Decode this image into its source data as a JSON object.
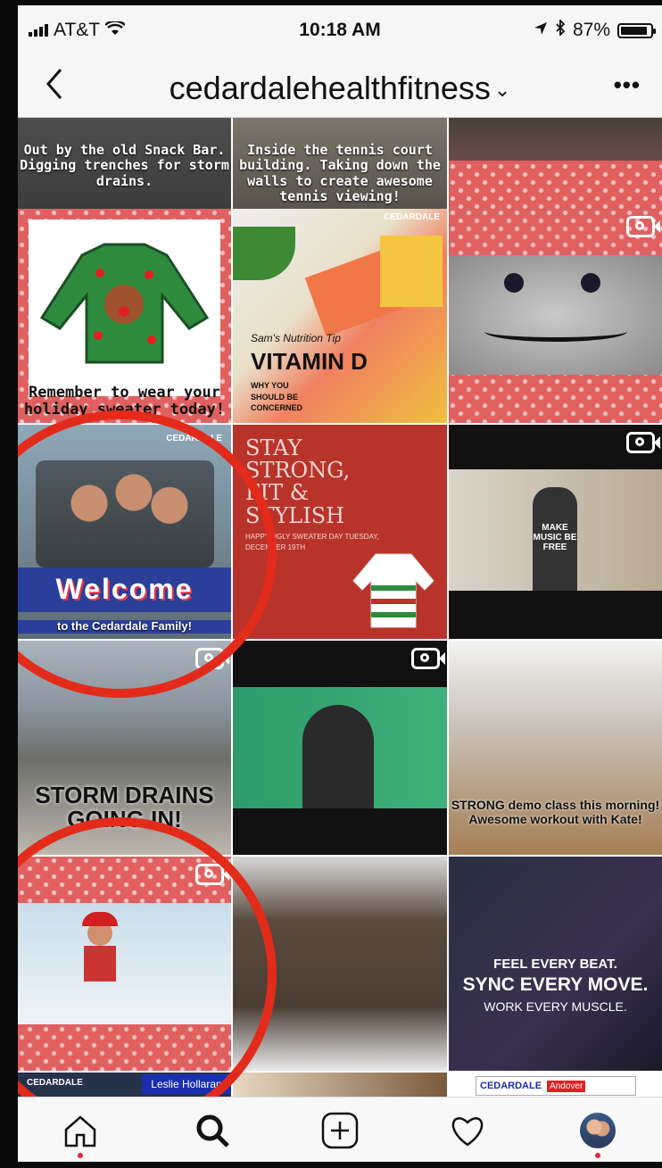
{
  "status_bar": {
    "carrier": "AT&T",
    "time": "10:18 AM",
    "battery": "87%"
  },
  "header": {
    "back_icon": "chevron-left-icon",
    "username": "cedardalehealthfitness",
    "more_icon": "more-dots-icon"
  },
  "grid": {
    "posts": [
      {
        "caption": "Out by the old Snack Bar. Digging trenches for storm drains.",
        "video": false
      },
      {
        "caption": "Inside the tennis court building. Taking down the walls to create awesome tennis viewing!",
        "video": false
      },
      {
        "caption": "",
        "video": false
      },
      {
        "caption": "Remember to wear your holiday sweater today!",
        "video": false
      },
      {
        "brand": "CEDARDALE",
        "kicker": "Sam's Nutrition Tip",
        "headline": "VITAMIN D",
        "sub": "WHY YOU SHOULD BE CONCERNED",
        "video": false
      },
      {
        "caption": "",
        "video": true
      },
      {
        "brand": "CEDARDALE",
        "headline": "Welcome",
        "sub": "to the Cedardale Family!",
        "video": false
      },
      {
        "headline": "STAY STRONG, FIT & STYLISH",
        "sub": "HAPPY UGLY SWEATER DAY TUESDAY, DECEMBER 19TH",
        "video": false
      },
      {
        "caption": "MAKE MUSIC BE FREE",
        "video": true
      },
      {
        "caption": "STORM DRAINS GOING IN!",
        "video": true
      },
      {
        "caption": "",
        "video": true
      },
      {
        "caption": "STRONG demo class this morning! Awesome workout with Kate!",
        "video": false
      },
      {
        "caption": "",
        "video": true
      },
      {
        "caption": "",
        "video": false
      },
      {
        "line1": "FEEL EVERY BEAT.",
        "line2": "SYNC EVERY MOVE.",
        "line3": "WORK EVERY MUSCLE.",
        "video": false
      },
      {
        "brand": "CEDARDALE",
        "name": "Leslie Hollaran",
        "video": false
      },
      {
        "caption": "",
        "video": false
      },
      {
        "brand": "CEDARDALE",
        "location": "Andover",
        "video": false
      }
    ]
  },
  "tabbar": {
    "items": [
      {
        "icon": "home-icon"
      },
      {
        "icon": "search-icon"
      },
      {
        "icon": "add-post-icon"
      },
      {
        "icon": "heart-icon"
      },
      {
        "icon": "profile-avatar-icon"
      }
    ]
  },
  "colors": {
    "annotation_ring": "#e32b1c",
    "notification_dot": "#e0283a"
  }
}
